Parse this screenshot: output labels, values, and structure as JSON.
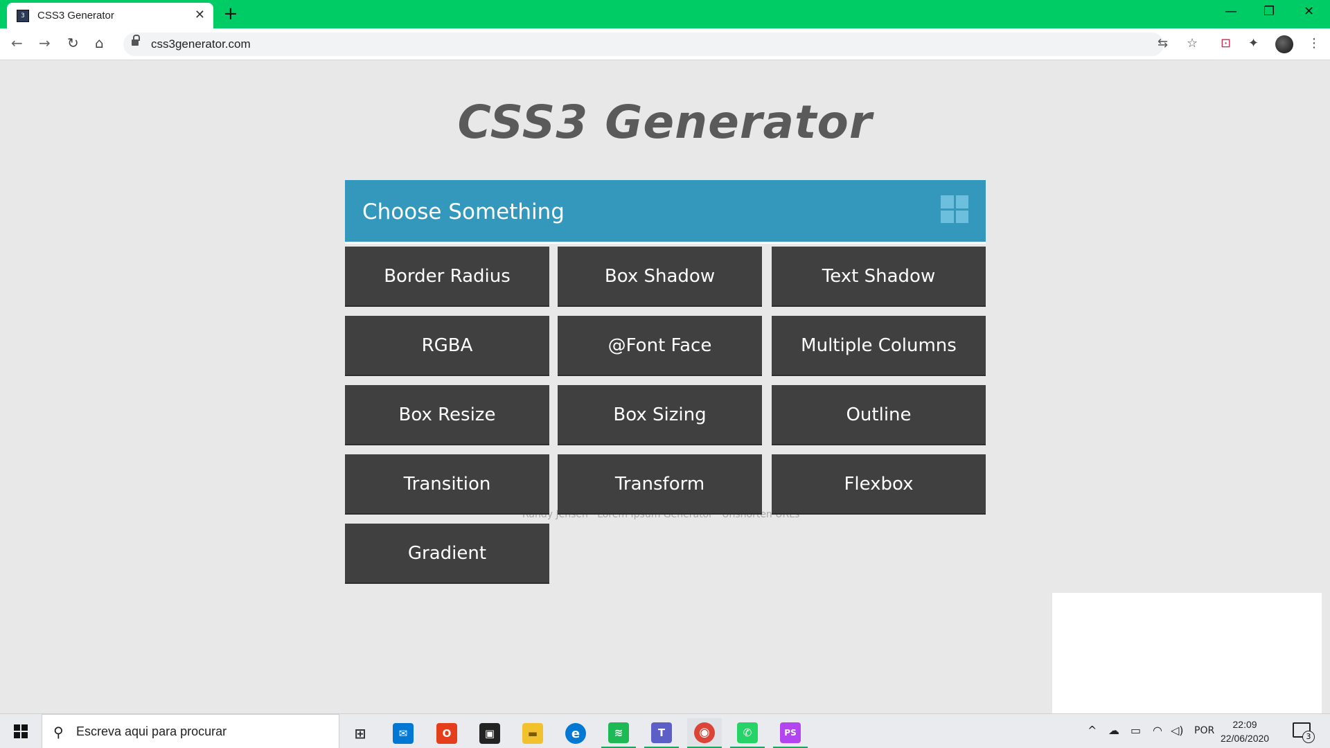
{
  "browser": {
    "tab_title": "CSS3 Generator",
    "tab_close": "✕",
    "new_tab": "+",
    "minimize": "—",
    "maximize": "❐",
    "close": "✕",
    "url": "css3generator.com",
    "back": "←",
    "forward": "→",
    "reload": "↻",
    "home": "⌂",
    "translate": "⇆",
    "bookmark": "☆",
    "extension": "⊡",
    "puzzle": "✦",
    "menu": "⋮",
    "tab_color": "#00cc66"
  },
  "page": {
    "title": "CSS3 Generator",
    "panel_header": "Choose Something",
    "header_color": "#3498bd",
    "tile_color": "#404040",
    "tiles": [
      "Border Radius",
      "Box Shadow",
      "Text Shadow",
      "RGBA",
      "@Font Face",
      "Multiple Columns",
      "Box Resize",
      "Box Sizing",
      "Outline",
      "Transition",
      "Transform",
      "Flexbox",
      "Gradient"
    ],
    "footer_links": "Randy Jensen · Lorem Ipsum Generator · Unshorten URLs"
  },
  "taskbar": {
    "search_placeholder": "Escreva aqui para procurar",
    "search_icon": "⚲",
    "apps": [
      {
        "name": "task-view",
        "glyph": "⊞",
        "color": "#333333"
      },
      {
        "name": "mail",
        "glyph": "✉",
        "color": "#0078d4"
      },
      {
        "name": "office",
        "glyph": "O",
        "color": "#e43e1c"
      },
      {
        "name": "store",
        "glyph": "▣",
        "color": "#222222"
      },
      {
        "name": "file-explorer",
        "glyph": "▬",
        "color": "#f2c12e"
      },
      {
        "name": "edge",
        "glyph": "e",
        "color": "#0078d4"
      },
      {
        "name": "spotify",
        "glyph": "≋",
        "color": "#1db954"
      },
      {
        "name": "teams",
        "glyph": "T",
        "color": "#5b5fc7"
      },
      {
        "name": "chrome",
        "glyph": "◉",
        "color": "#db4437"
      },
      {
        "name": "whatsapp",
        "glyph": "✆",
        "color": "#25d366"
      },
      {
        "name": "phpstorm",
        "glyph": "PS",
        "color": "#b345f1"
      }
    ],
    "language": "POR",
    "time": "22:09",
    "date": "22/06/2020",
    "notifications": "3",
    "tray_up": "^",
    "tray_cloud": "☁",
    "tray_battery": "▭",
    "tray_wifi": "◠",
    "tray_volume": "◁)"
  }
}
